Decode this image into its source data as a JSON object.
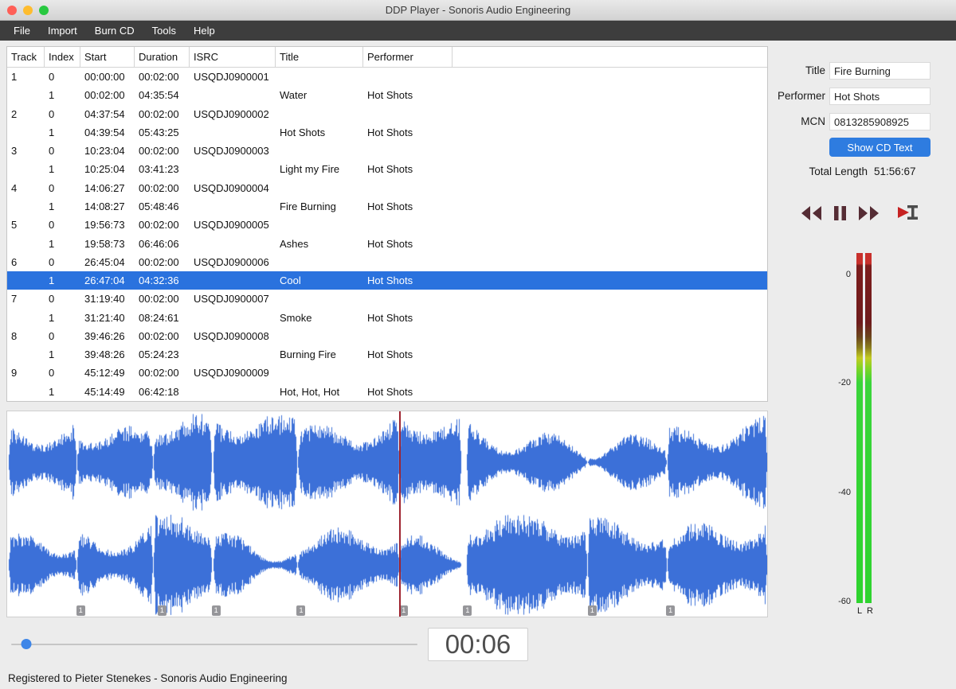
{
  "window": {
    "title": "DDP Player - Sonoris Audio Engineering"
  },
  "menu": {
    "items": [
      "File",
      "Import",
      "Burn CD",
      "Tools",
      "Help"
    ]
  },
  "table": {
    "columns": [
      "Track",
      "Index",
      "Start",
      "Duration",
      "ISRC",
      "Title",
      "Performer"
    ],
    "selected_index": 11,
    "rows": [
      {
        "track": "1",
        "index": "0",
        "start": "00:00:00",
        "duration": "00:02:00",
        "isrc": "USQDJ0900001",
        "title": "",
        "performer": ""
      },
      {
        "track": "",
        "index": "1",
        "start": "00:02:00",
        "duration": "04:35:54",
        "isrc": "",
        "title": "Water",
        "performer": "Hot Shots"
      },
      {
        "track": "2",
        "index": "0",
        "start": "04:37:54",
        "duration": "00:02:00",
        "isrc": "USQDJ0900002",
        "title": "",
        "performer": ""
      },
      {
        "track": "",
        "index": "1",
        "start": "04:39:54",
        "duration": "05:43:25",
        "isrc": "",
        "title": "Hot Shots",
        "performer": "Hot Shots"
      },
      {
        "track": "3",
        "index": "0",
        "start": "10:23:04",
        "duration": "00:02:00",
        "isrc": "USQDJ0900003",
        "title": "",
        "performer": ""
      },
      {
        "track": "",
        "index": "1",
        "start": "10:25:04",
        "duration": "03:41:23",
        "isrc": "",
        "title": "Light my Fire",
        "performer": "Hot Shots"
      },
      {
        "track": "4",
        "index": "0",
        "start": "14:06:27",
        "duration": "00:02:00",
        "isrc": "USQDJ0900004",
        "title": "",
        "performer": ""
      },
      {
        "track": "",
        "index": "1",
        "start": "14:08:27",
        "duration": "05:48:46",
        "isrc": "",
        "title": "Fire Burning",
        "performer": "Hot Shots"
      },
      {
        "track": "5",
        "index": "0",
        "start": "19:56:73",
        "duration": "00:02:00",
        "isrc": "USQDJ0900005",
        "title": "",
        "performer": ""
      },
      {
        "track": "",
        "index": "1",
        "start": "19:58:73",
        "duration": "06:46:06",
        "isrc": "",
        "title": "Ashes",
        "performer": "Hot Shots"
      },
      {
        "track": "6",
        "index": "0",
        "start": "26:45:04",
        "duration": "00:02:00",
        "isrc": "USQDJ0900006",
        "title": "",
        "performer": ""
      },
      {
        "track": "",
        "index": "1",
        "start": "26:47:04",
        "duration": "04:32:36",
        "isrc": "",
        "title": "Cool",
        "performer": "Hot Shots"
      },
      {
        "track": "7",
        "index": "0",
        "start": "31:19:40",
        "duration": "00:02:00",
        "isrc": "USQDJ0900007",
        "title": "",
        "performer": ""
      },
      {
        "track": "",
        "index": "1",
        "start": "31:21:40",
        "duration": "08:24:61",
        "isrc": "",
        "title": "Smoke",
        "performer": "Hot Shots"
      },
      {
        "track": "8",
        "index": "0",
        "start": "39:46:26",
        "duration": "00:02:00",
        "isrc": "USQDJ0900008",
        "title": "",
        "performer": ""
      },
      {
        "track": "",
        "index": "1",
        "start": "39:48:26",
        "duration": "05:24:23",
        "isrc": "",
        "title": "Burning Fire",
        "performer": "Hot Shots"
      },
      {
        "track": "9",
        "index": "0",
        "start": "45:12:49",
        "duration": "00:02:00",
        "isrc": "USQDJ0900009",
        "title": "",
        "performer": ""
      },
      {
        "track": "",
        "index": "1",
        "start": "45:14:49",
        "duration": "06:42:18",
        "isrc": "",
        "title": "Hot, Hot, Hot",
        "performer": "Hot Shots"
      }
    ]
  },
  "inspector": {
    "title_label": "Title",
    "title_value": "Fire Burning",
    "performer_label": "Performer",
    "performer_value": "Hot Shots",
    "mcn_label": "MCN",
    "mcn_value": "0813285908925",
    "show_cd_text_label": "Show CD Text",
    "total_length_label": "Total Length",
    "total_length_value": "51:56:67"
  },
  "meters": {
    "ticks": [
      "0",
      "-20",
      "-40",
      "-60"
    ],
    "left_label": "L",
    "right_label": "R"
  },
  "waveform": {
    "playhead_pos": 0.516,
    "segments": [
      {
        "start": 0.002,
        "end": 0.09
      },
      {
        "start": 0.092,
        "end": 0.191
      },
      {
        "start": 0.193,
        "end": 0.268
      },
      {
        "start": 0.271,
        "end": 0.38
      },
      {
        "start": 0.383,
        "end": 0.515
      },
      {
        "start": 0.517,
        "end": 0.596
      },
      {
        "start": 0.605,
        "end": 0.762
      },
      {
        "start": 0.764,
        "end": 0.867
      },
      {
        "start": 0.869,
        "end": 0.999
      }
    ],
    "markers": [
      {
        "pos": 0.091,
        "label": "1"
      },
      {
        "pos": 0.198,
        "label": "1"
      },
      {
        "pos": 0.269,
        "label": "1"
      },
      {
        "pos": 0.381,
        "label": "1"
      },
      {
        "pos": 0.516,
        "label": "1"
      },
      {
        "pos": 0.6,
        "label": "1"
      },
      {
        "pos": 0.764,
        "label": "1"
      },
      {
        "pos": 0.867,
        "label": "1"
      }
    ]
  },
  "player": {
    "time": "00:06",
    "slider_pos": 0.037
  },
  "status": {
    "text": "Registered to Pieter Stenekes - Sonoris Audio Engineering"
  },
  "colors": {
    "accent_blue": "#2e7ce0",
    "selection_blue": "#2a72de",
    "waveform_blue": "#3c70d8",
    "playhead_red": "#9e2430",
    "meter_green": "#2ed32e",
    "meter_red": "#c8302c"
  }
}
